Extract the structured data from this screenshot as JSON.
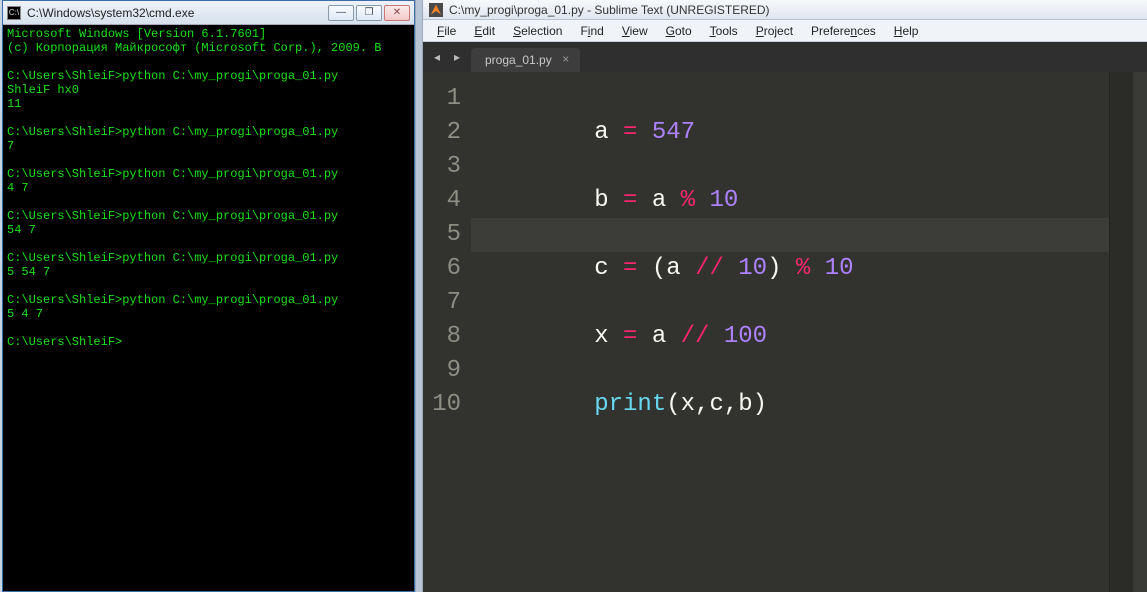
{
  "cmd": {
    "title": "C:\\Windows\\system32\\cmd.exe",
    "icon_label": "C:\\",
    "lines": [
      {
        "t": "Microsoft Windows [Version 6.1.7601]",
        "c": "g"
      },
      {
        "t": "(c) Корпорация Майкрософт (Microsoft Corp.), 2009. В",
        "c": "g"
      },
      {
        "t": "",
        "c": "g"
      },
      {
        "t": "C:\\Users\\ShleiF>python C:\\my_progi\\proga_01.py",
        "c": "g"
      },
      {
        "t": "ShleiF hx0",
        "c": "g"
      },
      {
        "t": "11",
        "c": "g"
      },
      {
        "t": "",
        "c": "g"
      },
      {
        "t": "C:\\Users\\ShleiF>python C:\\my_progi\\proga_01.py",
        "c": "g"
      },
      {
        "t": "7",
        "c": "g"
      },
      {
        "t": "",
        "c": "g"
      },
      {
        "t": "C:\\Users\\ShleiF>python C:\\my_progi\\proga_01.py",
        "c": "g"
      },
      {
        "t": "4 7",
        "c": "g"
      },
      {
        "t": "",
        "c": "g"
      },
      {
        "t": "C:\\Users\\ShleiF>python C:\\my_progi\\proga_01.py",
        "c": "g"
      },
      {
        "t": "54 7",
        "c": "g"
      },
      {
        "t": "",
        "c": "g"
      },
      {
        "t": "C:\\Users\\ShleiF>python C:\\my_progi\\proga_01.py",
        "c": "g"
      },
      {
        "t": "5 54 7",
        "c": "g"
      },
      {
        "t": "",
        "c": "g"
      },
      {
        "t": "C:\\Users\\ShleiF>python C:\\my_progi\\proga_01.py",
        "c": "g"
      },
      {
        "t": "5 4 7",
        "c": "g"
      },
      {
        "t": "",
        "c": "g"
      },
      {
        "t": "C:\\Users\\ShleiF>",
        "c": "g"
      }
    ],
    "btn_min": "—",
    "btn_max": "❐",
    "btn_close": "✕"
  },
  "sublime": {
    "title": "C:\\my_progi\\proga_01.py - Sublime Text (UNREGISTERED)",
    "menus": [
      {
        "label": "File",
        "u": "F"
      },
      {
        "label": "Edit",
        "u": "E"
      },
      {
        "label": "Selection",
        "u": "S"
      },
      {
        "label": "Find",
        "u": "i"
      },
      {
        "label": "View",
        "u": "V"
      },
      {
        "label": "Goto",
        "u": "G"
      },
      {
        "label": "Tools",
        "u": "T"
      },
      {
        "label": "Project",
        "u": "P"
      },
      {
        "label": "Preferences",
        "u": "n"
      },
      {
        "label": "Help",
        "u": "H"
      }
    ],
    "nav_prev": "◂",
    "nav_next": "▸",
    "tab": {
      "label": "proga_01.py",
      "close": "×"
    },
    "gutter": [
      "1",
      "2",
      "3",
      "4",
      "5",
      "6",
      "7",
      "8",
      "9",
      "10"
    ],
    "code": {
      "l1": {
        "v": "a",
        "eq": "=",
        "n": "547"
      },
      "l3": {
        "v": "b",
        "eq": "=",
        "a": "a",
        "op": "%",
        "n": "10"
      },
      "l5": {
        "v": "c",
        "eq": "=",
        "lp": "(",
        "a": "a",
        "fd": "//",
        "n1": "10",
        "rp": ")",
        "op": "%",
        "n2": "10"
      },
      "l7": {
        "v": "x",
        "eq": "=",
        "a": "a",
        "fd": "//",
        "n": "100"
      },
      "l9": {
        "fn": "print",
        "lp": "(",
        "args": "x,c,b",
        "rp": ")"
      }
    }
  }
}
